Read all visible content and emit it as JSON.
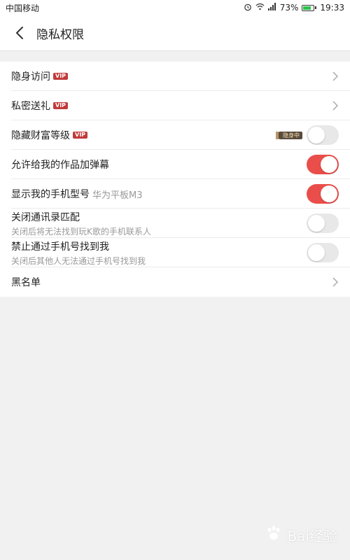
{
  "status_bar": {
    "carrier": "中国移动",
    "battery_percent": "73%",
    "battery_level": 0.73,
    "time": "19:33",
    "icons": [
      "alarm-icon",
      "wifi-icon",
      "signal-icon",
      "battery-icon"
    ]
  },
  "header": {
    "title": "隐私权限",
    "back_icon": "back-arrow-icon"
  },
  "settings": {
    "items": [
      {
        "label": "隐身访问",
        "vip": "VIP",
        "control": "chevron"
      },
      {
        "label": "私密送礼",
        "vip": "VIP",
        "control": "chevron"
      },
      {
        "label": "隐藏财富等级",
        "vip": "VIP",
        "tag": "隐身中",
        "control": "toggle",
        "on": false
      },
      {
        "label": "允许给我的作品加弹幕",
        "control": "toggle",
        "on": true
      },
      {
        "label": "显示我的手机型号",
        "label_suffix": "华为平板M3",
        "control": "toggle",
        "on": true
      },
      {
        "label": "关闭通讯录匹配",
        "sub": "关闭后将无法找到玩K歌的手机联系人",
        "control": "toggle",
        "on": false
      },
      {
        "label": "禁止通过手机号找到我",
        "sub": "关闭后其他人无法通过手机号找到我",
        "control": "toggle",
        "on": false
      },
      {
        "label": "黑名单",
        "control": "chevron"
      }
    ]
  },
  "watermark": {
    "text": "Bai经验"
  },
  "colors": {
    "toggle_on": "#ea4e4a",
    "toggle_off": "#e8e8e8",
    "vip": "#c13a3a",
    "background": "#f1f1f1"
  }
}
